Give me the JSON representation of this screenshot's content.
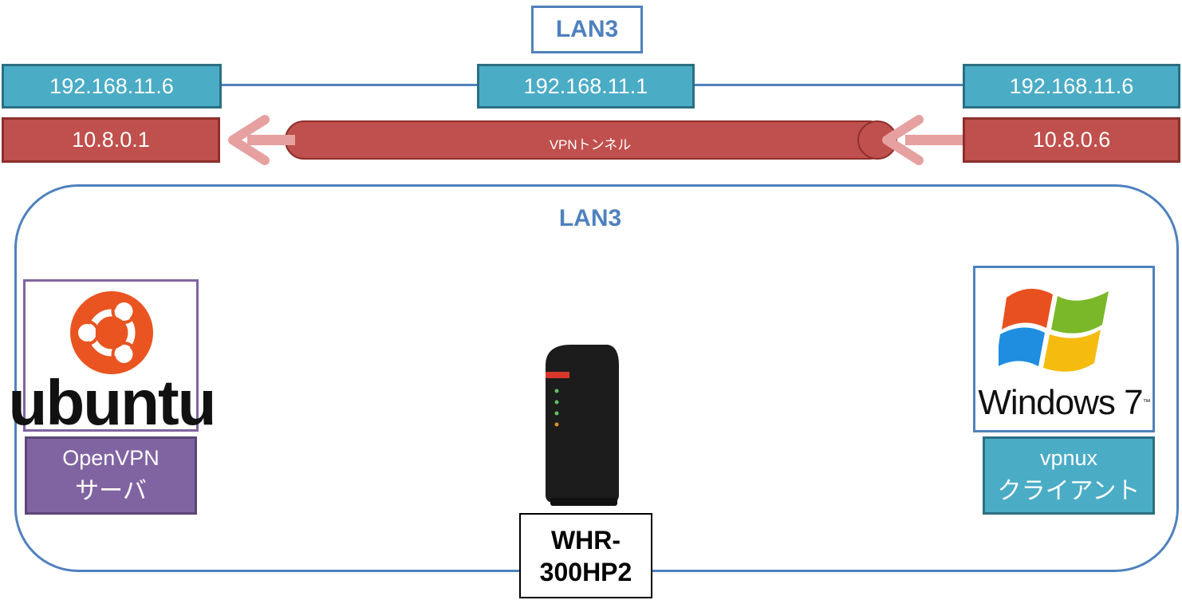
{
  "top_title": "LAN3",
  "top_row": {
    "left_ip": "192.168.11.6",
    "center_ip": "192.168.11.1",
    "right_ip": "192.168.11.6"
  },
  "vpn_row": {
    "left_ip": "10.8.0.1",
    "tunnel_label": "VPNトンネル",
    "right_ip": "10.8.0.6"
  },
  "region": {
    "label": "LAN3"
  },
  "server": {
    "logo_text": "ubuntu",
    "line1": "OpenVPN",
    "line2": "サーバ"
  },
  "client": {
    "logo_text": "Windows 7",
    "logo_tm": "™",
    "line1": "vpnux",
    "line2": "クライアント"
  },
  "router": {
    "line1": "WHR-",
    "line2": "300HP2"
  },
  "colors": {
    "lan_blue": "#4f81bd",
    "ip_cyan": "#4bacc6",
    "vpn_red": "#c0504d",
    "arrow_pink": "#e6a0a0",
    "server_purple": "#8064a2",
    "ubuntu_orange": "#e95420"
  },
  "icons": [
    "ubuntu-logo-icon",
    "windows-logo-icon",
    "router-device-icon",
    "arrow-left-icon"
  ]
}
